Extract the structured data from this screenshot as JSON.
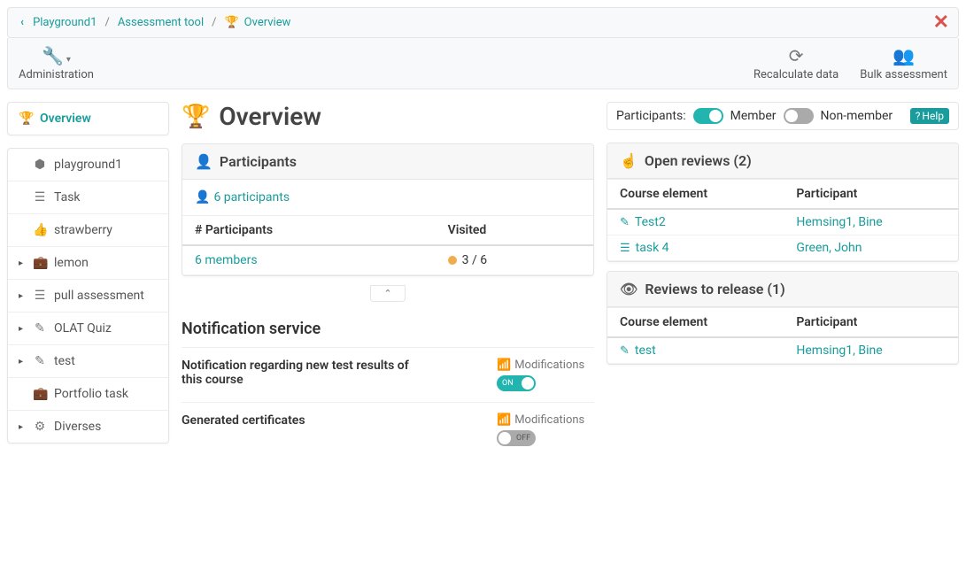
{
  "breadcrumbs": {
    "chevron": "‹",
    "item1": "Playground1",
    "item2": "Assessment tool",
    "item3_icon": "🏆",
    "item3": "Overview"
  },
  "toolbar": {
    "administration": "Administration",
    "recalculate": "Recalculate data",
    "bulk": "Bulk assessment"
  },
  "sidebar": {
    "overview": "Overview",
    "items": [
      {
        "label": "playground1",
        "caret": false
      },
      {
        "label": "Task",
        "caret": false,
        "indent": true
      },
      {
        "label": "strawberry",
        "caret": false,
        "indent": true
      },
      {
        "label": "lemon",
        "caret": true
      },
      {
        "label": "pull assessment",
        "caret": true
      },
      {
        "label": "OLAT Quiz",
        "caret": true
      },
      {
        "label": "test",
        "caret": true
      },
      {
        "label": "Portfolio task",
        "caret": false,
        "indent": true
      },
      {
        "label": "Diverses",
        "caret": true
      }
    ]
  },
  "page_title": "Overview",
  "filters": {
    "label": "Participants:",
    "member": "Member",
    "nonmember": "Non-member",
    "help": "Help"
  },
  "participants_panel": {
    "title": "Participants",
    "link": "6 participants",
    "col1": "# Participants",
    "col2": "Visited",
    "row_members": "6 members",
    "row_visited": "3 / 6"
  },
  "notifications": {
    "heading": "Notification service",
    "row1": "Notification regarding new test results of this course",
    "row2": "Generated certificates",
    "modifications": "Modifications",
    "on_text": "ON",
    "off_text": "OFF"
  },
  "open_reviews": {
    "title": "Open reviews (2)",
    "col1": "Course element",
    "col2": "Participant",
    "rows": [
      {
        "element": "Test2",
        "participant": "Hemsing1, Bine"
      },
      {
        "element": "task 4",
        "participant": "Green, John"
      }
    ]
  },
  "reviews_release": {
    "title": "Reviews to release (1)",
    "col1": "Course element",
    "col2": "Participant",
    "rows": [
      {
        "element": "test",
        "participant": "Hemsing1, Bine"
      }
    ]
  }
}
